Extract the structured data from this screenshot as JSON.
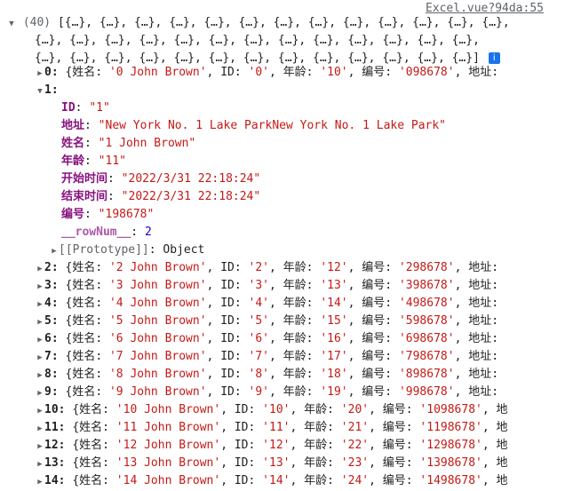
{
  "source_link": "Excel.vue?94da:55",
  "array_count": "(40)",
  "summary_lines": [
    "[{…}, {…}, {…}, {…}, {…}, {…}, {…}, {…}, {…}, {…}, {…}, {…}, {…},",
    "{…}, {…}, {…}, {…}, {…}, {…}, {…}, {…}, {…}, {…}, {…}, {…}, {…},",
    "{…}, {…}, {…}, {…}, {…}, {…}, {…}, {…}, {…}, {…}, {…}, {…}, {…}]"
  ],
  "row0": {
    "index": "0:",
    "text_prefix": "{姓名: ",
    "name": "'0 John Brown'",
    "id_key": "ID: ",
    "id": "'0'",
    "age_key": "年龄: ",
    "age": "'10'",
    "code_key": "编号: ",
    "code": "'098678'",
    "tail": "地址:"
  },
  "expanded": {
    "index": "1:",
    "fields": [
      {
        "key": "ID",
        "value": "\"1\""
      },
      {
        "key": "地址",
        "value": "\"New York No. 1 Lake ParkNew York No. 1 Lake Park\""
      },
      {
        "key": "姓名",
        "value": "\"1 John Brown\""
      },
      {
        "key": "年龄",
        "value": "\"11\""
      },
      {
        "key": "开始时间",
        "value": "\"2022/3/31 22:18:24\""
      },
      {
        "key": "结束时间",
        "value": "\"2022/3/31 22:18:24\""
      },
      {
        "key": "编号",
        "value": "\"198678\""
      }
    ],
    "rownum_key": "__rowNum__",
    "rownum_value": "2",
    "prototype_label": "[[Prototype]]",
    "prototype_value": "Object"
  },
  "rows": [
    {
      "index": "2:",
      "name": "'2 John Brown'",
      "id": "'2'",
      "age": "'12'",
      "code": "'298678'",
      "tail": "地址:"
    },
    {
      "index": "3:",
      "name": "'3 John Brown'",
      "id": "'3'",
      "age": "'13'",
      "code": "'398678'",
      "tail": "地址:"
    },
    {
      "index": "4:",
      "name": "'4 John Brown'",
      "id": "'4'",
      "age": "'14'",
      "code": "'498678'",
      "tail": "地址:"
    },
    {
      "index": "5:",
      "name": "'5 John Brown'",
      "id": "'5'",
      "age": "'15'",
      "code": "'598678'",
      "tail": "地址:"
    },
    {
      "index": "6:",
      "name": "'6 John Brown'",
      "id": "'6'",
      "age": "'16'",
      "code": "'698678'",
      "tail": "地址:"
    },
    {
      "index": "7:",
      "name": "'7 John Brown'",
      "id": "'7'",
      "age": "'17'",
      "code": "'798678'",
      "tail": "地址:"
    },
    {
      "index": "8:",
      "name": "'8 John Brown'",
      "id": "'8'",
      "age": "'18'",
      "code": "'898678'",
      "tail": "地址:"
    },
    {
      "index": "9:",
      "name": "'9 John Brown'",
      "id": "'9'",
      "age": "'19'",
      "code": "'998678'",
      "tail": "地址:"
    },
    {
      "index": "10:",
      "name": "'10 John Brown'",
      "id": "'10'",
      "age": "'20'",
      "code": "'1098678'",
      "tail": "地"
    },
    {
      "index": "11:",
      "name": "'11 John Brown'",
      "id": "'11'",
      "age": "'21'",
      "code": "'1198678'",
      "tail": "地"
    },
    {
      "index": "12:",
      "name": "'12 John Brown'",
      "id": "'12'",
      "age": "'22'",
      "code": "'1298678'",
      "tail": "地"
    },
    {
      "index": "13:",
      "name": "'13 John Brown'",
      "id": "'13'",
      "age": "'23'",
      "code": "'1398678'",
      "tail": "地"
    },
    {
      "index": "14:",
      "name": "'14 John Brown'",
      "id": "'14'",
      "age": "'24'",
      "code": "'1498678'",
      "tail": "地"
    }
  ],
  "labels": {
    "name_key": "姓名: ",
    "id_key": "ID: ",
    "age_key": "年龄: ",
    "code_key": "编号: ",
    "open": "{",
    "comma": ", "
  },
  "colors": {
    "key": "#881280",
    "string": "#c41a16",
    "number": "#1c00cf",
    "info": "#1a73e8"
  }
}
